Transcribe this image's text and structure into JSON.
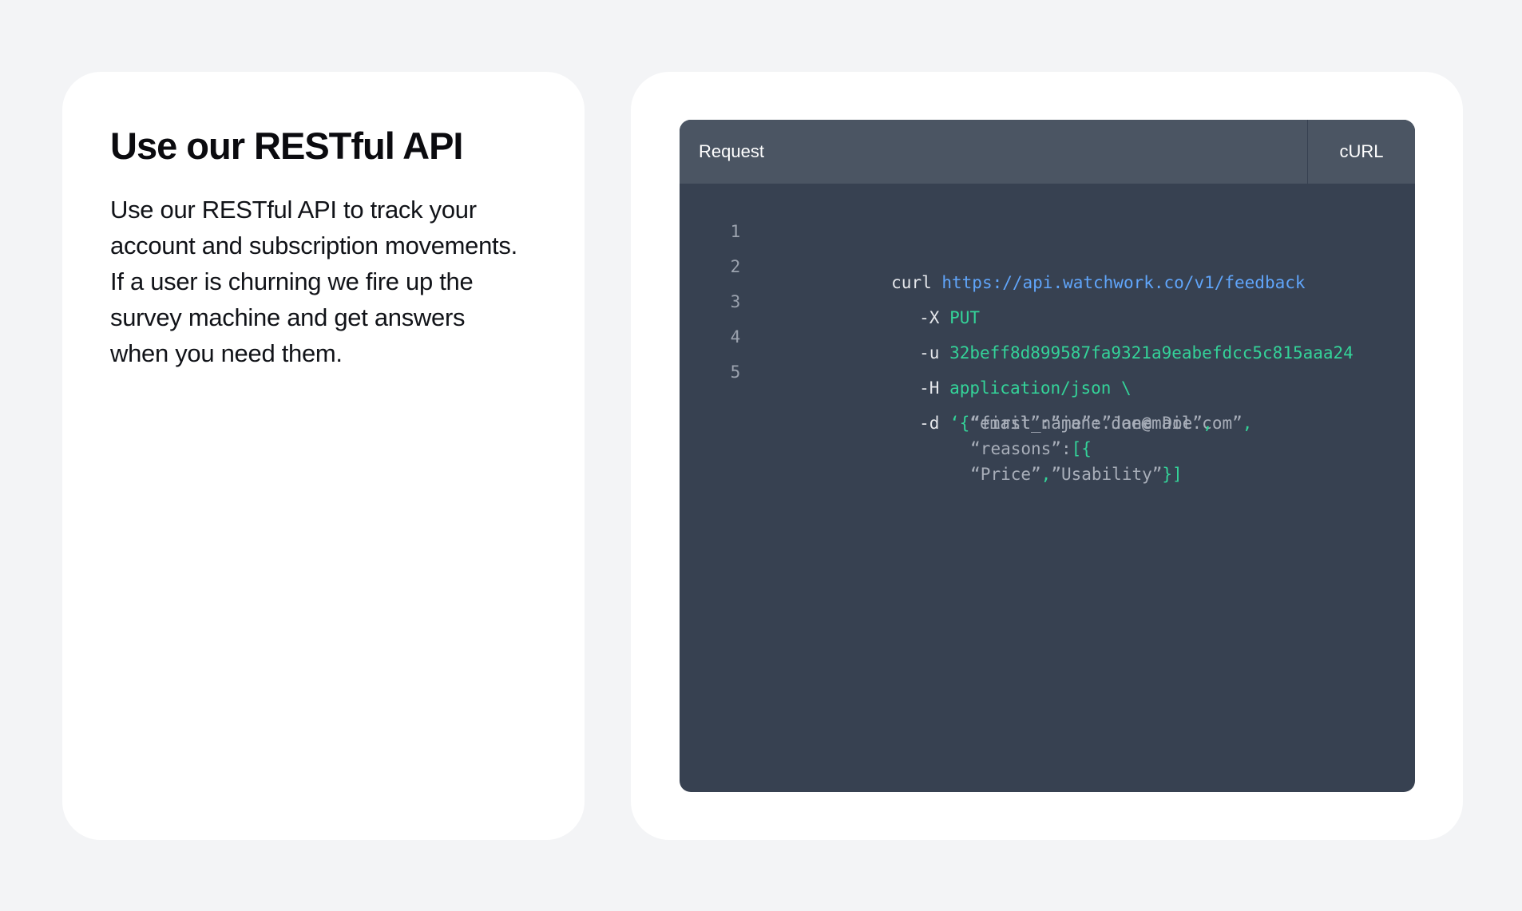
{
  "left_card": {
    "title": "Use our RESTful API",
    "description": "Use our RESTful API to track your account and subscription movements. If a user is churning we fire up the survey machine and get answers when you need them."
  },
  "code_panel": {
    "header_title": "Request",
    "language_tab": "cURL",
    "lines": [
      {
        "number": "1",
        "cmd": "curl ",
        "url": "https://api.watchwork.co/v1/feedback"
      },
      {
        "number": "2",
        "flag": "-X ",
        "value": "PUT"
      },
      {
        "number": "3",
        "flag": "-u ",
        "value": "32beff8d899587fa9321a9eabefdcc5c815aaa24"
      },
      {
        "number": "4",
        "flag": "-H ",
        "value": "application/json \\"
      },
      {
        "number": "5",
        "flag": "-d ",
        "tokens": {
          "quote_open": "‘{",
          "email_key": "“email”:”jane.doe@mail.com”",
          "comma1": ",",
          "first_name_key": "“first_name”:”Jane Doe”",
          "comma2": ",",
          "reasons_key": "“reasons”:",
          "array_open": "[{",
          "price": "“Price”",
          "comma3": ",",
          "usability": "”Usability”",
          "close": "}]"
        }
      }
    ]
  },
  "colors": {
    "background": "#f3f4f6",
    "card": "#ffffff",
    "code_bg": "#374151",
    "code_header_bg": "#4b5563",
    "url": "#60a5fa",
    "value_green": "#34d399",
    "string_gray": "#a8aeb9"
  }
}
